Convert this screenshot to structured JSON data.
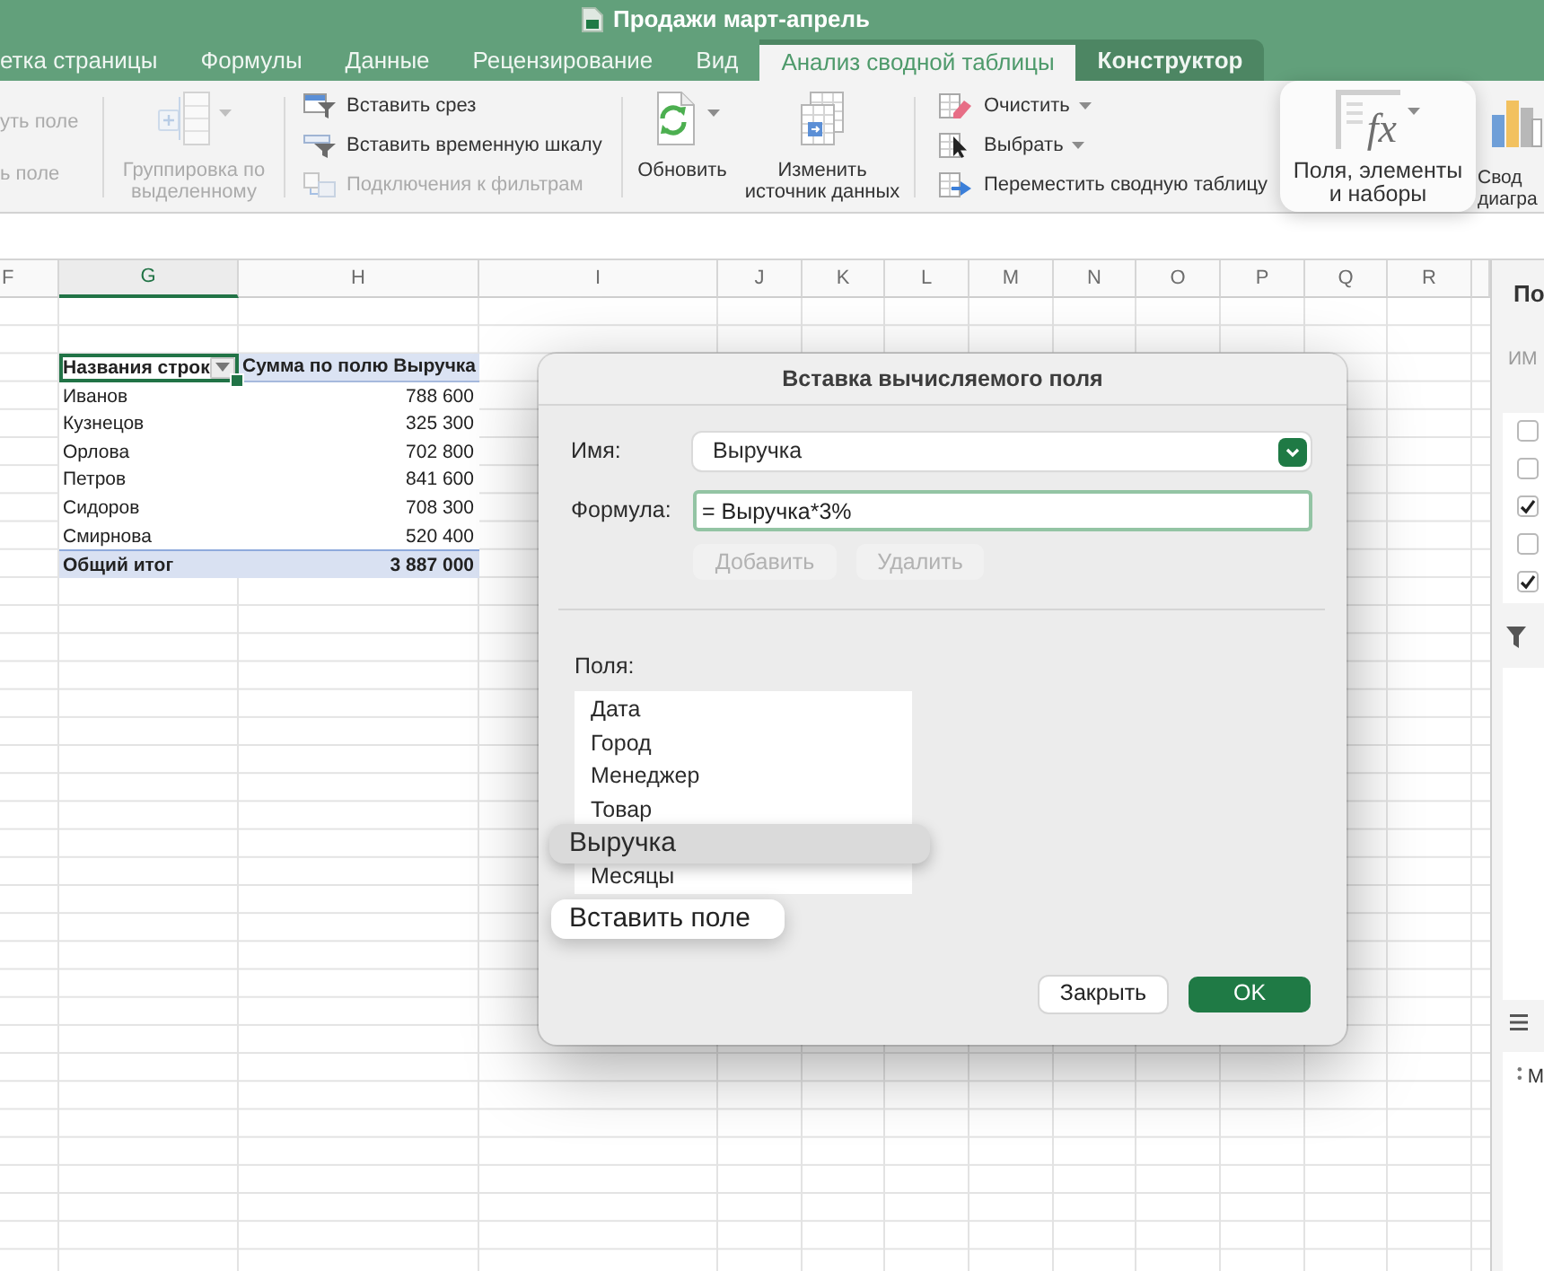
{
  "window": {
    "title": "Продажи март-апрель"
  },
  "tabs": [
    {
      "label": "етка страницы",
      "selected": false,
      "contextual": false
    },
    {
      "label": "Формулы",
      "selected": false,
      "contextual": false
    },
    {
      "label": "Данные",
      "selected": false,
      "contextual": false
    },
    {
      "label": "Рецензирование",
      "selected": false,
      "contextual": false
    },
    {
      "label": "Вид",
      "selected": false,
      "contextual": false
    },
    {
      "label": "Анализ сводной таблицы",
      "selected": true,
      "contextual": true
    },
    {
      "label": "Конструктор",
      "selected": false,
      "contextual": true
    }
  ],
  "ribbon": {
    "field_buttons": [
      {
        "label": "уть поле",
        "disabled": true
      },
      {
        "label": "ь поле",
        "disabled": true
      }
    ],
    "group_button": {
      "label": "Группировка по выделенному",
      "disabled": true,
      "dropdown": true
    },
    "filter_buttons": [
      {
        "label": "Вставить срез",
        "disabled": false
      },
      {
        "label": "Вставить временную шкалу",
        "disabled": false
      },
      {
        "label": "Подключения к фильтрам",
        "disabled": true
      }
    ],
    "refresh_button": {
      "label": "Обновить",
      "dropdown": true
    },
    "source_button": {
      "label": "Изменить источник данных"
    },
    "table_buttons": [
      {
        "label": "Очистить",
        "dropdown": true
      },
      {
        "label": "Выбрать",
        "dropdown": true
      },
      {
        "label": "Переместить сводную таблицу",
        "dropdown": false
      }
    ],
    "calc_button": {
      "symbol": "fx",
      "label": "Поля, элементы и наборы",
      "dropdown": true,
      "highlighted": true
    },
    "chart_button": {
      "label": "Свод диагра"
    }
  },
  "sheet": {
    "columns": [
      {
        "label": "F",
        "selected": false
      },
      {
        "label": "G",
        "selected": true
      },
      {
        "label": "H",
        "selected": false
      },
      {
        "label": "I",
        "selected": false
      },
      {
        "label": "J",
        "selected": false
      },
      {
        "label": "K",
        "selected": false
      },
      {
        "label": "L",
        "selected": false
      },
      {
        "label": "M",
        "selected": false
      },
      {
        "label": "N",
        "selected": false
      },
      {
        "label": "O",
        "selected": false
      },
      {
        "label": "P",
        "selected": false
      },
      {
        "label": "Q",
        "selected": false
      },
      {
        "label": "R",
        "selected": false
      }
    ],
    "pivot": {
      "row_header": {
        "label": "Названия строк",
        "active": true
      },
      "value_header": "Сумма по полю Выручка",
      "rows": [
        {
          "name": "Иванов",
          "value": "788 600"
        },
        {
          "name": "Кузнецов",
          "value": "325 300"
        },
        {
          "name": "Орлова",
          "value": "702 800"
        },
        {
          "name": "Петров",
          "value": "841 600"
        },
        {
          "name": "Сидоров",
          "value": "708 300"
        },
        {
          "name": "Смирнова",
          "value": "520 400"
        }
      ],
      "total": {
        "name": "Общий итог",
        "value": "3 887 000"
      }
    }
  },
  "dialog": {
    "title": "Вставка вычисляемого поля",
    "name_field": {
      "label": "Имя:",
      "value": "Выручка"
    },
    "formula_field": {
      "label": "Формула:",
      "value": "= Выручка*3%",
      "focused": true
    },
    "edit_buttons": [
      {
        "label": "Добавить",
        "disabled": true
      },
      {
        "label": "Удалить",
        "disabled": true
      }
    ],
    "fields_label": "Поля:",
    "fields": [
      {
        "label": "Дата",
        "selected": false
      },
      {
        "label": "Город",
        "selected": false
      },
      {
        "label": "Менеджер",
        "selected": false
      },
      {
        "label": "Товар",
        "selected": false
      },
      {
        "label": "Выручка",
        "selected": true
      },
      {
        "label": "Месяцы",
        "selected": false
      }
    ],
    "insert_button": {
      "label": "Вставить поле"
    },
    "footer_buttons": [
      {
        "label": "Закрыть",
        "primary": false
      },
      {
        "label": "OK",
        "primary": true
      }
    ]
  },
  "field_pane": {
    "title": "По",
    "column_label": "ИМ",
    "checkboxes": [
      {
        "checked": false
      },
      {
        "checked": false
      },
      {
        "checked": true
      },
      {
        "checked": false
      },
      {
        "checked": true
      }
    ],
    "row_item": "М"
  }
}
